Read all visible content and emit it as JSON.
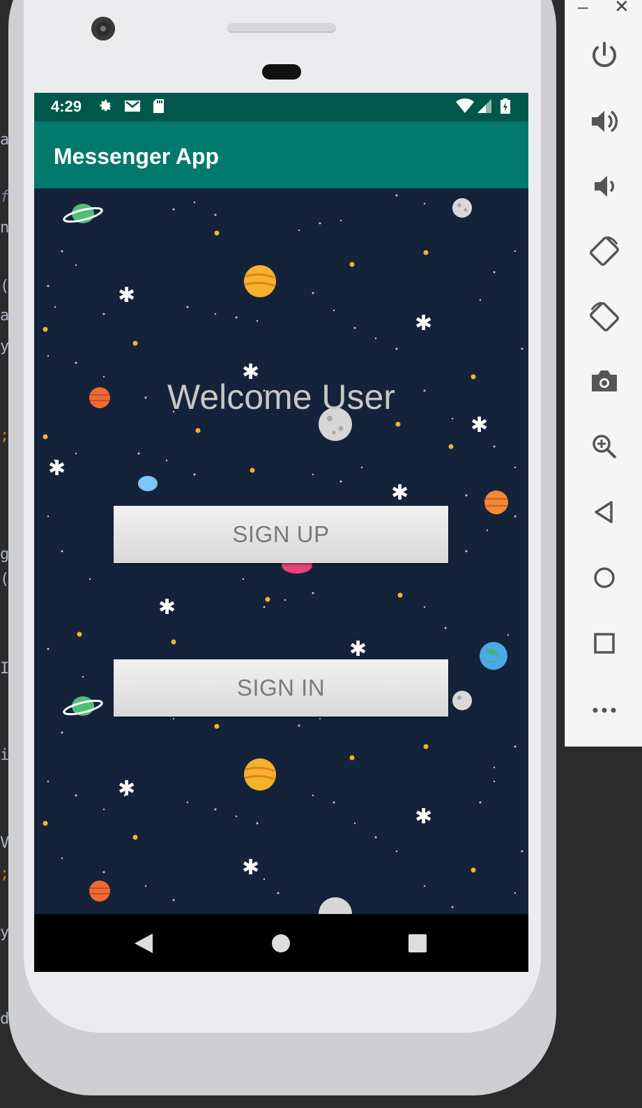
{
  "status_bar": {
    "time": "4:29",
    "icons": [
      "gear-icon",
      "gmail-icon",
      "sd-card-icon",
      "wifi-icon",
      "cell-signal-icon",
      "battery-charging-icon"
    ]
  },
  "app_bar": {
    "title": "Messenger App"
  },
  "main": {
    "welcome_text": "Welcome User",
    "signup_label": "SIGN UP",
    "signin_label": "SIGN IN"
  },
  "nav_bar": {
    "buttons": [
      "back-icon",
      "home-icon",
      "recents-icon"
    ]
  },
  "emulator_tools": [
    "power-icon",
    "volume-up-icon",
    "volume-down-icon",
    "rotate-left-icon",
    "rotate-right-icon",
    "camera-icon",
    "zoom-icon",
    "back-icon",
    "home-icon",
    "overview-icon",
    "more-icon"
  ],
  "colors": {
    "status_bar": "#02574c",
    "app_bar": "#01796b",
    "space_background": "#15233a",
    "button_gradient_top": "#f1f1f1",
    "button_gradient_bottom": "#d8d8d8"
  }
}
